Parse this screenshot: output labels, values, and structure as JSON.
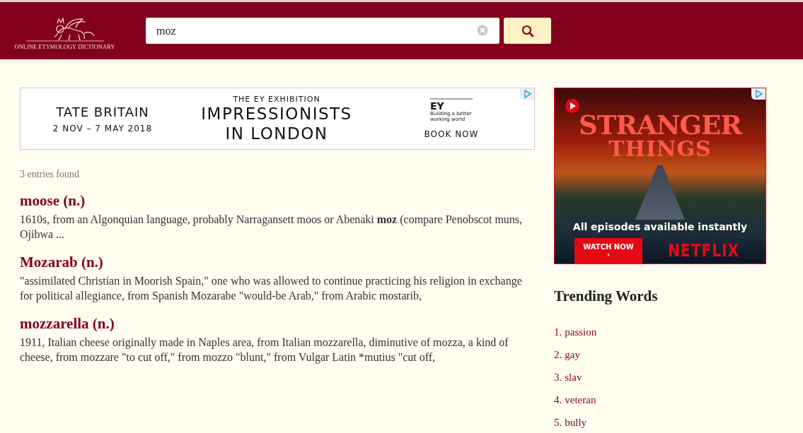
{
  "header": {
    "logo_text": "ONLINE ETYMOLOGY DICTIONARY",
    "search": {
      "value": "moz"
    }
  },
  "banner_ad": {
    "left_title": "TATE BRITAIN",
    "left_dates": "2 NOV – 7 MAY 2018",
    "kicker": "THE EY EXHIBITION",
    "headline_1": "IMPRESSIONISTS",
    "headline_2": "IN LONDON",
    "brand": "EY",
    "brand_tagline": "Building a better working world",
    "cta": "BOOK NOW"
  },
  "results": {
    "count": "3 entries found",
    "entries": [
      {
        "title": "moose (n.)",
        "snippet": "1610s, from an Algonquian language, probably Narragansett moos or Abenaki **moz** (compare Penobscot muns, Ojibwa ..."
      },
      {
        "title": "Mozarab (n.)",
        "snippet": "\"assimilated Christian in Moorish Spain,\" one who was allowed to continue practicing his religion in exchange for political allegiance, from Spanish Mozarabe \"would-be Arab,\" from Arabic mostarib,"
      },
      {
        "title": "mozzarella (n.)",
        "snippet": "1911, Italian cheese originally made in Naples area, from Italian mozzarella, diminutive of mozza, a kind of cheese, from mozzare \"to cut off,\" from mozzo \"blunt,\" from Vulgar Latin *mutius \"cut off,"
      }
    ]
  },
  "side_ad": {
    "title_1": "STRANGER",
    "title_2": "THINGS",
    "tagline": "All episodes available instantly",
    "cta": "WATCH NOW ›",
    "brand": "NETFLIX"
  },
  "trending": {
    "title": "Trending Words",
    "items": [
      {
        "number": "1.",
        "word": "passion"
      },
      {
        "number": "2.",
        "word": "gay"
      },
      {
        "number": "3.",
        "word": "slav"
      },
      {
        "number": "4.",
        "word": "veteran"
      },
      {
        "number": "5.",
        "word": "bully"
      }
    ]
  }
}
